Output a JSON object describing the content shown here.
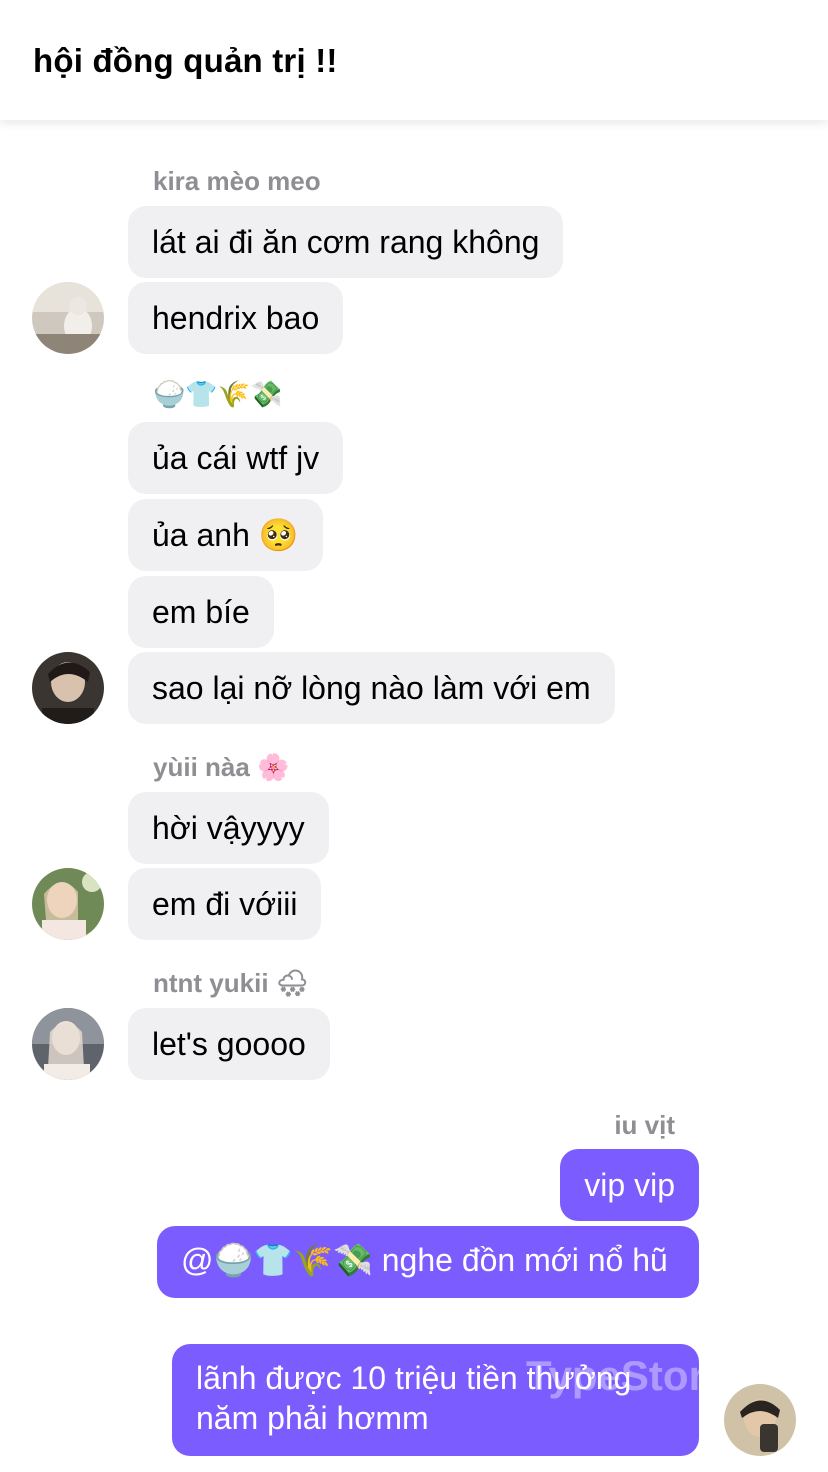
{
  "header": {
    "title": "hội đồng quản trị !!"
  },
  "senders": {
    "kira": "kira mèo meo",
    "emoji_user": "🍚👕🌾💸",
    "yui": "yùii nàa",
    "yui_emoji": "🌸",
    "yukii": "ntnt yukii",
    "yukii_emoji": "🌨",
    "me": "iu vịt"
  },
  "messages": {
    "m1": "lát ai đi ăn cơm rang không",
    "m2": "hendrix bao",
    "m3": "ủa cái wtf jv",
    "m4": "ủa anh 🥺",
    "m5": "em bíe",
    "m6": "sao lại nỡ lòng nào làm với em",
    "m7": "hời vậyyyy",
    "m8": "em đi vớiii",
    "m9": "let's goooo",
    "m10": "vip vip",
    "m11": "@🍚👕🌾💸 nghe đồn mới nổ hũ",
    "m12": "lãnh được 10 triệu tiền thưởng năm phải hơmm"
  },
  "watermark": "TypeStory",
  "colors": {
    "outgoing_bubble": "#7b5cff",
    "incoming_bubble": "#f0f0f2",
    "sender_name": "#8e8e93"
  }
}
